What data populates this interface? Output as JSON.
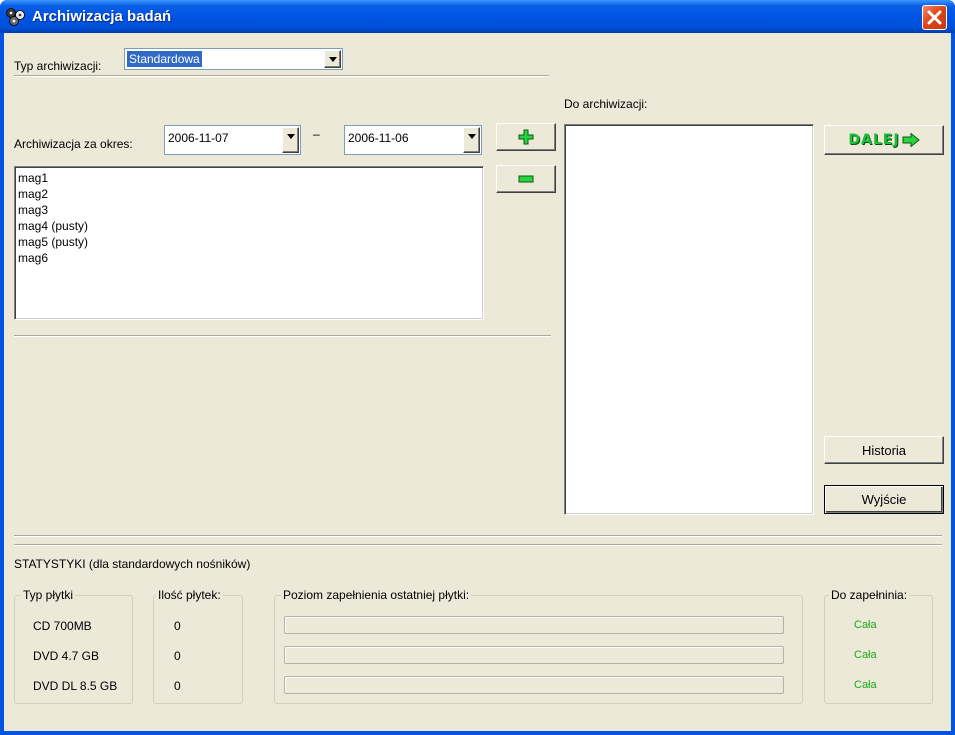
{
  "window": {
    "title": "Archiwizacja badań"
  },
  "typ": {
    "label": "Typ archiwizacji:",
    "value": "Standardowa"
  },
  "okres": {
    "label": "Archiwizacja za okres:",
    "from": "2006-11-07",
    "separator": "–",
    "to": "2006-11-06"
  },
  "source_list": {
    "items": [
      "mag1",
      "mag2",
      "mag3",
      "mag4 (pusty)",
      "mag5 (pusty)",
      "mag6"
    ]
  },
  "target": {
    "label": "Do archiwizacji:",
    "items": []
  },
  "buttons": {
    "add_icon": "plus-icon",
    "remove_icon": "minus-icon",
    "dalej": "DALEJ",
    "dalej_icon": "arrow-right-icon",
    "historia": "Historia",
    "wyjscie": "Wyjście"
  },
  "stats": {
    "heading": "STATYSTYKI (dla standardowych nośników)",
    "col_typ": "Typ płytki",
    "col_ilosc": "Ilość  płytek:",
    "col_poziom": "Poziom zapełnienia ostatniej płytki:",
    "col_do": "Do zapełninia:",
    "rows": [
      {
        "typ": "CD 700MB",
        "ilosc": "0",
        "fill": 0,
        "do": "Cała"
      },
      {
        "typ": "DVD  4.7 GB",
        "ilosc": "0",
        "fill": 0,
        "do": "Cała"
      },
      {
        "typ": "DVD DL 8.5 GB",
        "ilosc": "0",
        "fill": 0,
        "do": "Cała"
      }
    ]
  },
  "colors": {
    "titlebar": "#0054e3",
    "client": "#ece9d8",
    "selection": "#316ac5",
    "green": "#1ea81e"
  }
}
